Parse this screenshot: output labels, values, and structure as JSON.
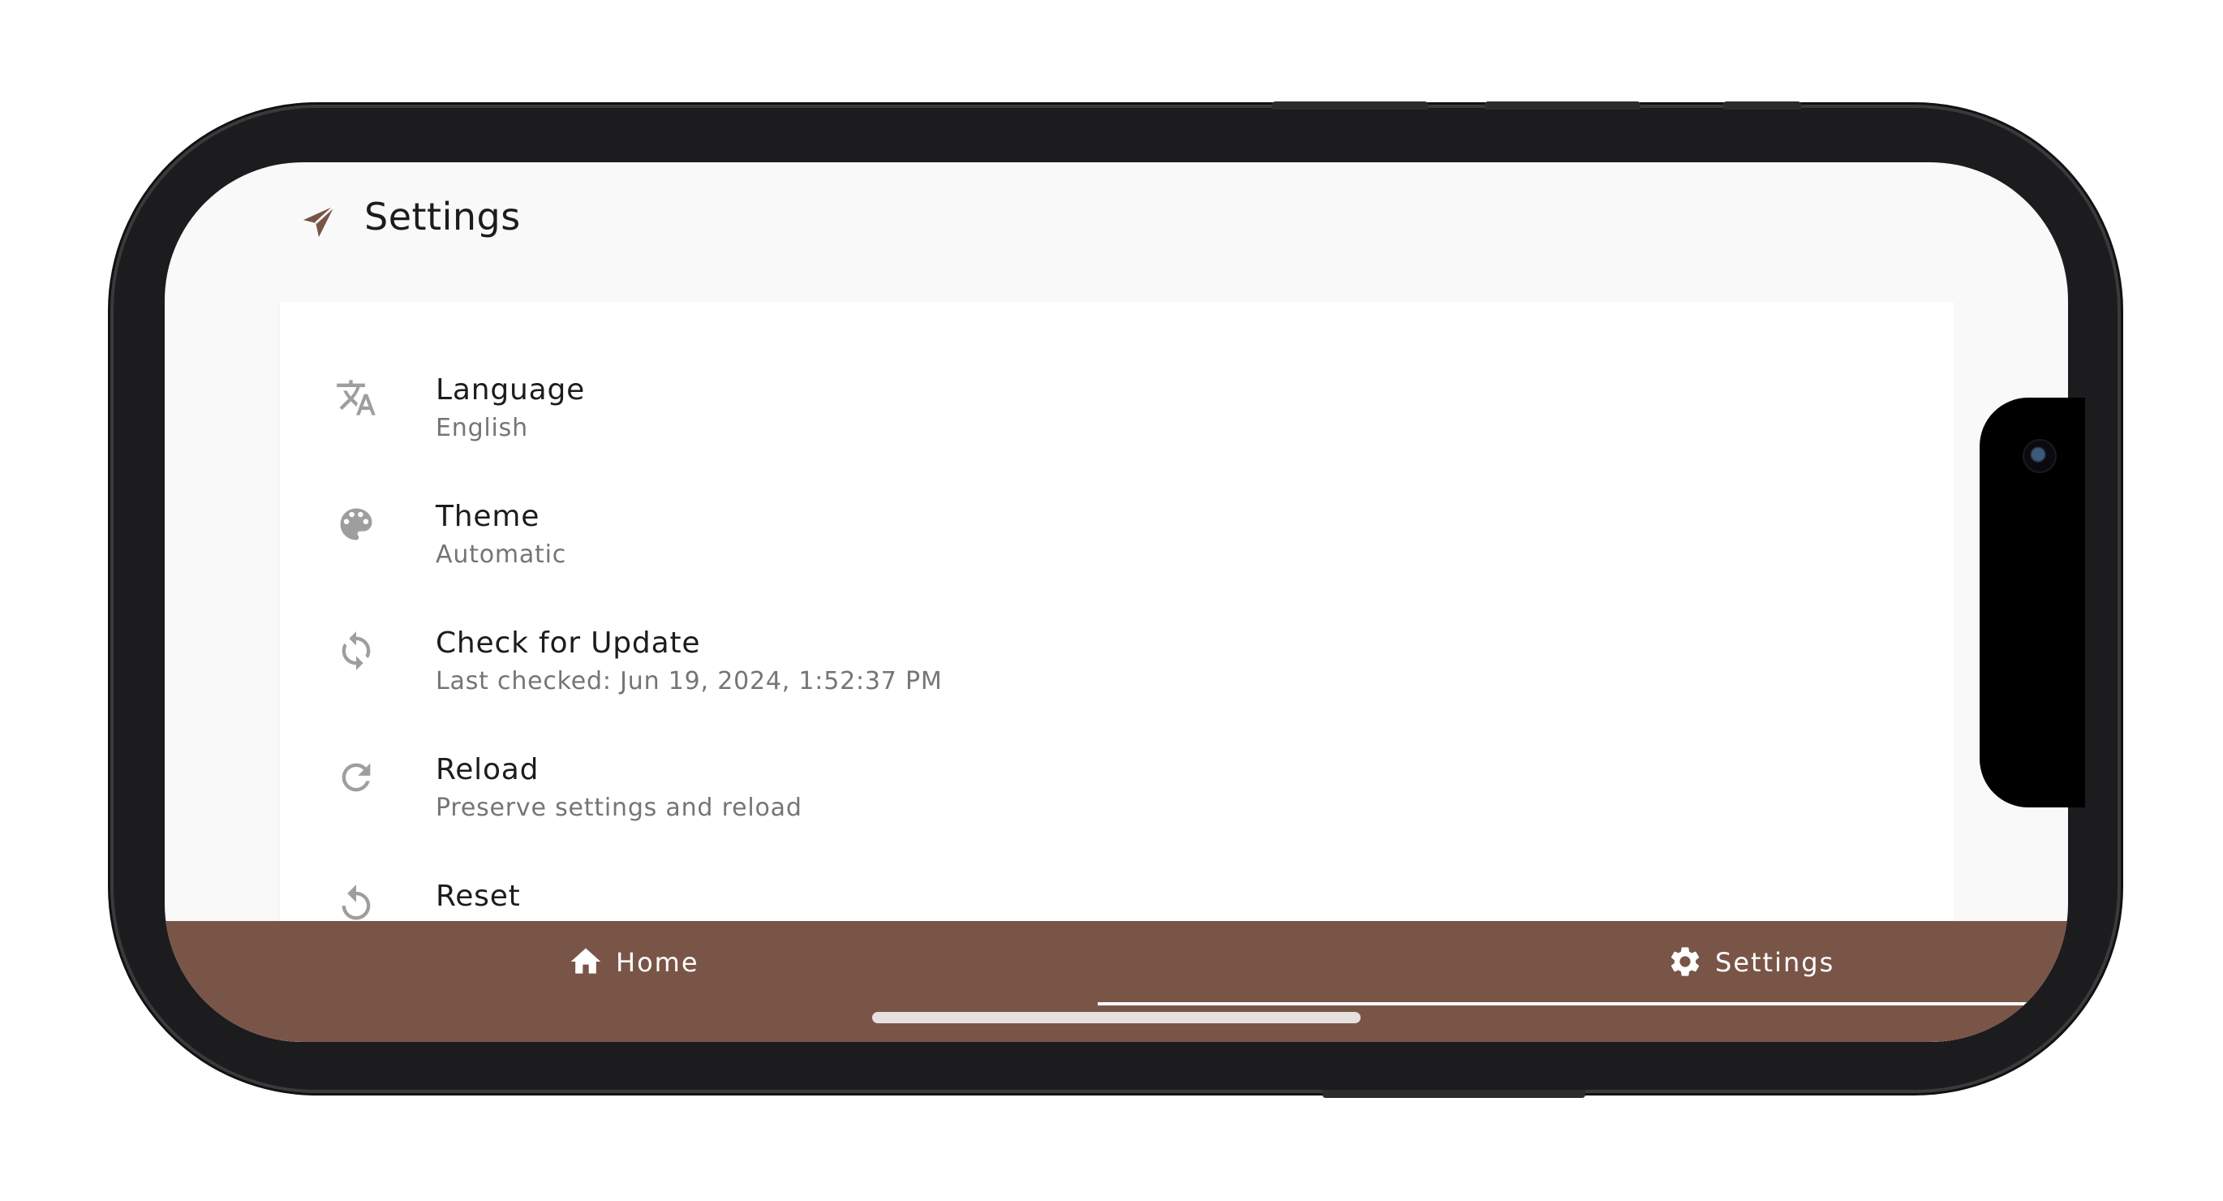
{
  "header": {
    "title": "Settings",
    "icon": "paper-plane-icon"
  },
  "settings": [
    {
      "title": "Language",
      "subtitle": "English",
      "icon": "translate-icon"
    },
    {
      "title": "Theme",
      "subtitle": "Automatic",
      "icon": "palette-icon"
    },
    {
      "title": "Check for Update",
      "subtitle": "Last checked: Jun 19, 2024, 1:52:37 PM",
      "icon": "sync-icon"
    },
    {
      "title": "Reload",
      "subtitle": "Preserve settings and reload",
      "icon": "refresh-icon"
    },
    {
      "title": "Reset",
      "subtitle": "",
      "icon": "restore-icon"
    }
  ],
  "nav": {
    "tabs": [
      {
        "label": "Home",
        "icon": "home-icon"
      },
      {
        "label": "Settings",
        "icon": "gear-icon"
      }
    ],
    "active": "Settings"
  },
  "colors": {
    "accent": "#795548",
    "icon_gray": "#9e9e9e"
  }
}
